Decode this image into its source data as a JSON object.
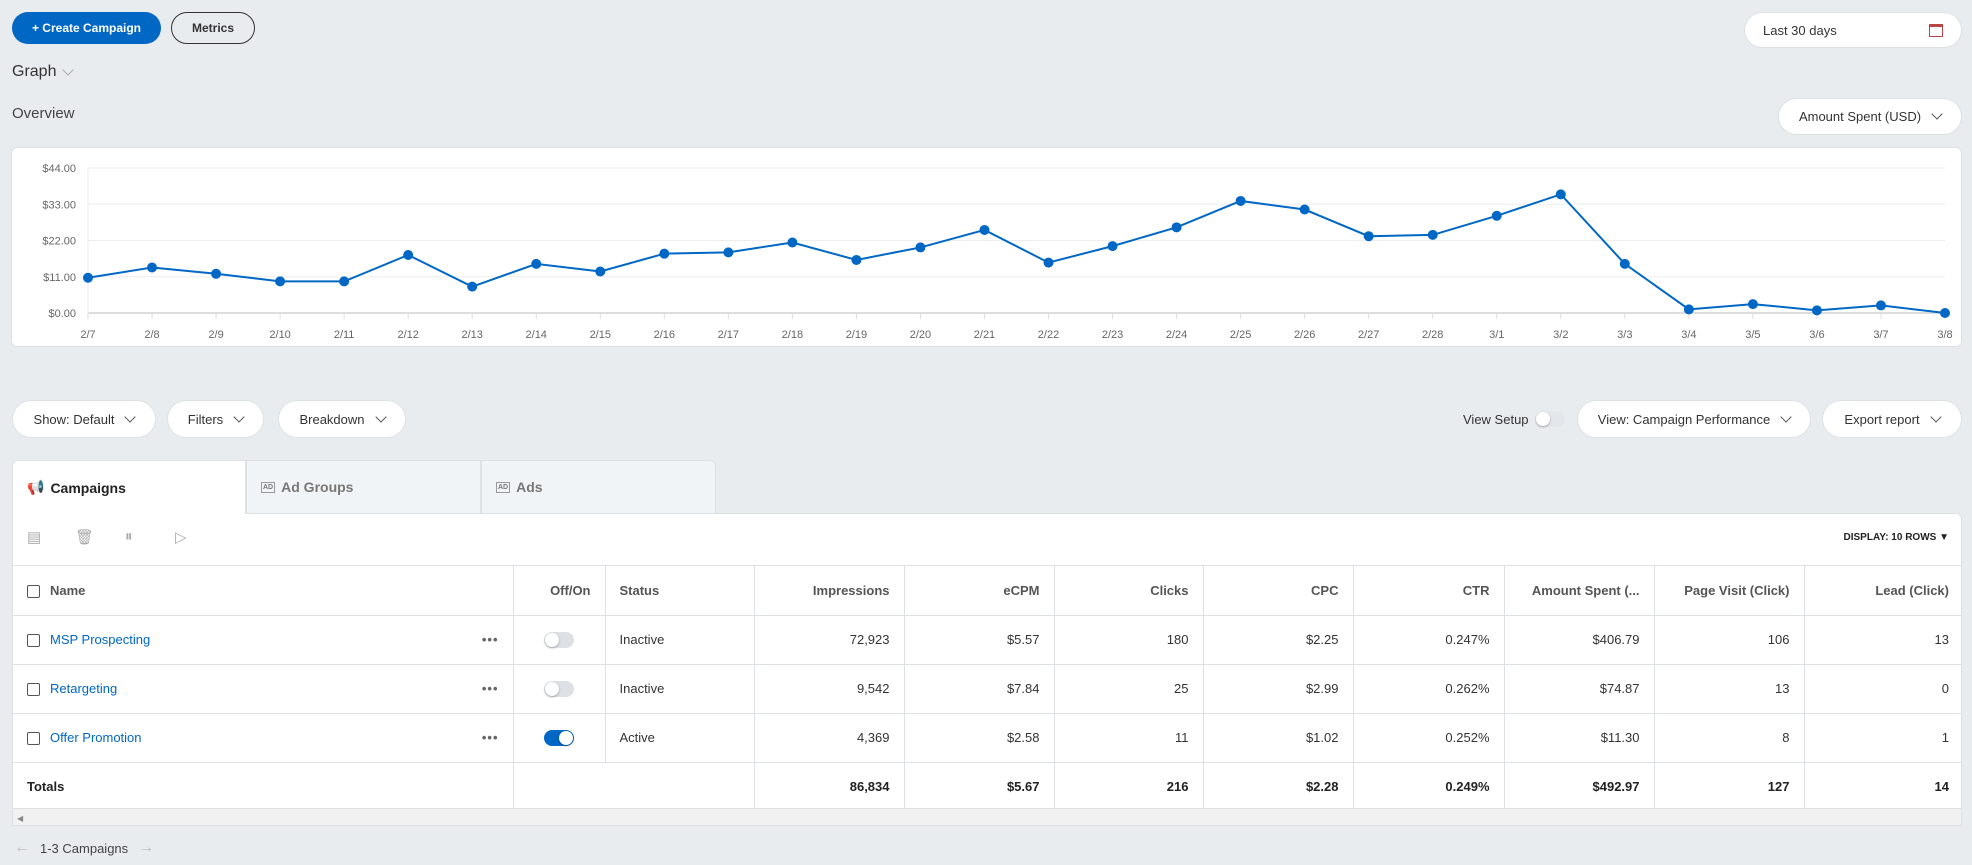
{
  "toolbar": {
    "create_label": "+ Create Campaign",
    "metrics_label": "Metrics",
    "date_range": "Last 30 days"
  },
  "graph": {
    "label": "Graph",
    "overview_label": "Overview",
    "metric_select": "Amount Spent (USD)"
  },
  "chart_data": {
    "type": "line",
    "x": [
      "2/7",
      "2/8",
      "2/9",
      "2/10",
      "2/11",
      "2/12",
      "2/13",
      "2/14",
      "2/15",
      "2/16",
      "2/17",
      "2/18",
      "2/19",
      "2/20",
      "2/21",
      "2/22",
      "2/23",
      "2/24",
      "2/25",
      "2/26",
      "2/27",
      "2/28",
      "3/1",
      "3/2",
      "3/3",
      "3/4",
      "3/5",
      "3/6",
      "3/7",
      "3/8"
    ],
    "values": [
      10.7,
      13.8,
      11.9,
      9.6,
      9.6,
      17.6,
      8.0,
      14.9,
      12.6,
      18.0,
      18.4,
      21.4,
      16.1,
      19.9,
      25.2,
      15.3,
      20.3,
      26.0,
      34.0,
      31.4,
      23.3,
      23.7,
      29.5,
      36.0,
      14.9,
      1.1,
      2.7,
      0.8,
      2.3,
      0.0
    ],
    "y_ticks": [
      "$0.00",
      "$11.00",
      "$22.00",
      "$33.00",
      "$44.00"
    ],
    "ylim": [
      0,
      44
    ],
    "grid": true,
    "color": "#0067c5"
  },
  "controls": {
    "show": "Show: Default",
    "filters": "Filters",
    "breakdown": "Breakdown",
    "view_setup": "View Setup",
    "view_setup_on": false,
    "view": "View: Campaign Performance",
    "export": "Export report"
  },
  "tabs": [
    {
      "label": "Campaigns",
      "active": true
    },
    {
      "label": "Ad Groups",
      "active": false
    },
    {
      "label": "Ads",
      "active": false
    }
  ],
  "table": {
    "display_rows": "DISPLAY: 10 ROWS ▼",
    "headers": [
      "Name",
      "Off/On",
      "Status",
      "Impressions",
      "eCPM",
      "Clicks",
      "CPC",
      "CTR",
      "Amount Spent (...",
      "Page Visit (Click)",
      "Lead (Click)"
    ],
    "rows": [
      {
        "name": "MSP Prospecting",
        "on": false,
        "status": "Inactive",
        "impressions": "72,923",
        "ecpm": "$5.57",
        "clicks": "180",
        "cpc": "$2.25",
        "ctr": "0.247%",
        "spent": "$406.79",
        "page_visit": "106",
        "lead": "13"
      },
      {
        "name": "Retargeting",
        "on": false,
        "status": "Inactive",
        "impressions": "9,542",
        "ecpm": "$7.84",
        "clicks": "25",
        "cpc": "$2.99",
        "ctr": "0.262%",
        "spent": "$74.87",
        "page_visit": "13",
        "lead": "0"
      },
      {
        "name": "Offer Promotion",
        "on": true,
        "status": "Active",
        "impressions": "4,369",
        "ecpm": "$2.58",
        "clicks": "11",
        "cpc": "$1.02",
        "ctr": "0.252%",
        "spent": "$11.30",
        "page_visit": "8",
        "lead": "1"
      }
    ],
    "totals": {
      "label": "Totals",
      "impressions": "86,834",
      "ecpm": "$5.67",
      "clicks": "216",
      "cpc": "$2.28",
      "ctr": "0.249%",
      "spent": "$492.97",
      "page_visit": "127",
      "lead": "14"
    }
  },
  "footer": {
    "range": "1-3 Campaigns"
  }
}
